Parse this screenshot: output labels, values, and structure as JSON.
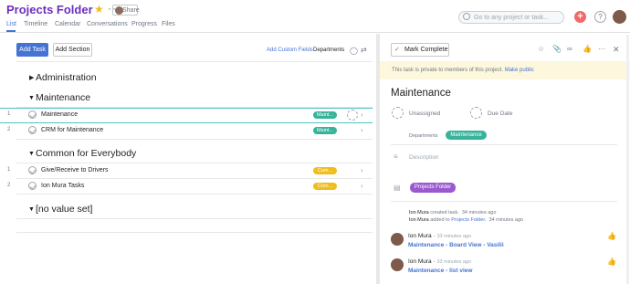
{
  "header": {
    "title": "Projects Folder",
    "share_label": "Share",
    "tabs": [
      "List",
      "Timeline",
      "Calendar",
      "Conversations",
      "Progress",
      "Files"
    ],
    "active_tab": "List",
    "search_placeholder": "Go to any project or task..."
  },
  "toolbar": {
    "add_task": "Add Task",
    "add_section": "Add Section",
    "add_custom_fields": "Add Custom Fields",
    "departments": "Departments"
  },
  "sections": [
    {
      "name": "Administration",
      "expanded": false,
      "tasks": []
    },
    {
      "name": "Maintenance",
      "expanded": true,
      "tasks": [
        {
          "num": "1",
          "name": "Maintenance",
          "tag": "Maint...",
          "tag_color": "#37b39b"
        },
        {
          "num": "2",
          "name": "CRM for Maintenance",
          "tag": "Maint...",
          "tag_color": "#37b39b"
        }
      ]
    },
    {
      "name": "Common for Everybody",
      "expanded": true,
      "tasks": [
        {
          "num": "1",
          "name": "Give/Receive to Drivers",
          "tag": "Com...",
          "tag_color": "#f1bd1e"
        },
        {
          "num": "2",
          "name": "Ion Mura Tasks",
          "tag": "Com...",
          "tag_color": "#f1bd1e"
        }
      ]
    },
    {
      "name": "[no value set]",
      "expanded": true,
      "tasks": []
    }
  ],
  "detail": {
    "mark_complete": "Mark Complete",
    "private_notice": "This task is private to members of this project.",
    "make_public": "Make public",
    "title": "Maintenance",
    "assignee": "Unassigned",
    "due_date": "Due Date",
    "departments_label": "Departments",
    "departments_value": "Maintenance",
    "description_placeholder": "Description",
    "project": "Projects Folder",
    "activity": [
      {
        "who": "Ion Mura",
        "action": "created task.",
        "time": "34 minutes ago"
      },
      {
        "who": "Ion Mura",
        "action": "added to",
        "target": "Projects Folder.",
        "time": "34 minutes ago"
      }
    ],
    "comments": [
      {
        "author": "Ion Mura",
        "time": "33 minutes ago",
        "text": "Maintenance - Board View - Vasilii"
      },
      {
        "author": "Ion Mura",
        "time": "33 minutes ago",
        "text": "Maintenance - list view"
      }
    ]
  },
  "colors": {
    "accent": "#4573d2",
    "title_purple": "#6c2fbd",
    "green_tag": "#37b39b",
    "yellow_tag": "#f1bd1e"
  }
}
